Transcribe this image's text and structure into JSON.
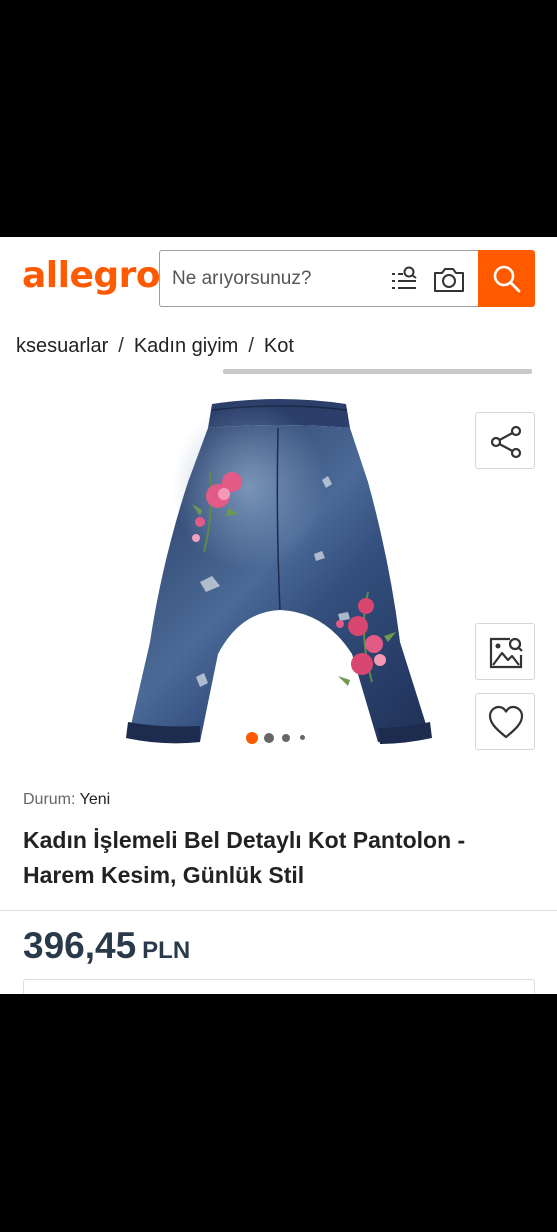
{
  "header": {
    "logo_text": "allegro",
    "search_placeholder": "Ne arıyorsunuz?",
    "brand_color": "#ff5a00"
  },
  "breadcrumb": {
    "items": [
      "ksesuarlar",
      "Kadın giyim",
      "Kot"
    ],
    "separator": "/"
  },
  "gallery": {
    "image_alt": "denim harem jeans with embroidered flowers",
    "slide_count": 4,
    "active_slide": 1,
    "icons": [
      "share-icon",
      "image-search-icon",
      "heart-icon"
    ]
  },
  "product": {
    "condition_label": "Durum:",
    "condition_value": "Yeni",
    "title": "Kadın İşlemeli Bel Detaylı Kot Pantolon - Harem Kesim, Günlük Stil",
    "price_value": "396,45",
    "price_currency": "PLN"
  }
}
